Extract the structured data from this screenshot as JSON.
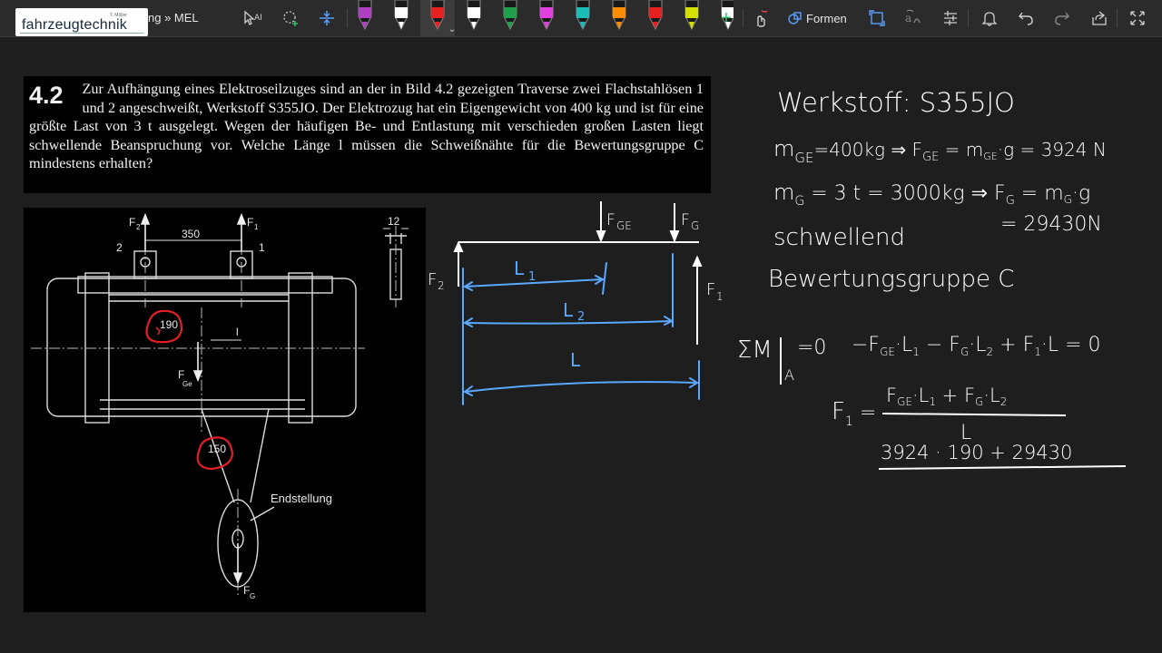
{
  "logo": {
    "text": "fahrzeugtechnik",
    "small_text": "T. Möller"
  },
  "breadcrumb": "ng » MEL",
  "toolbar": {
    "formen_label": "Formen",
    "pen_colors": [
      "#b03fc4",
      "#ffffff",
      "#e82020",
      "#ffffff",
      "#1fa04b",
      "#e040e0",
      "#1abeb6",
      "#ff8c00",
      "#e82020",
      "#d4e000",
      "#ffffff"
    ]
  },
  "task": {
    "number": "4.2",
    "text": "Zur Aufhängung eines Elektroseilzuges sind an der in Bild 4.2 gezeigten Traverse zwei Flachstahlösen 1 und 2 angeschweißt, Werkstoff S355JO. Der Elektrozug hat ein Eigengewicht von 400 kg und ist für eine größte Last von 3 t ausgelegt. Wegen der häufigen Be- und Entlastung mit verschieden großen Lasten liegt schwellende Beanspruchung vor. Welche Länge l müssen die Schweißnähte für die Bewertungsgruppe C mindestens erhalten?"
  },
  "figure": {
    "f2": "F",
    "f2_sub": "2",
    "f1": "F",
    "f1_sub": "1",
    "dim_350": "350",
    "dim_12": "12",
    "label_1": "1",
    "label_2": "2",
    "dim_190": "190",
    "dim_l": "l",
    "fge": "F",
    "fge_sub": "Ge",
    "dim_150": "150",
    "endstellung": "Endstellung",
    "fg": "F",
    "fg_sub": "G"
  },
  "sketch": {
    "fge": "F",
    "fge_sub": "GE",
    "fg": "F",
    "fg_sub": "G",
    "f2": "F",
    "f2_sub": "2",
    "f1": "F",
    "f1_sub": "1",
    "l1": "L",
    "l1_sub": "1",
    "l2": "L",
    "l2_sub": "2",
    "l": "L"
  },
  "notes": {
    "line1": "Werkstoff: S355JO",
    "mge": "m",
    "mge_sub": "GE",
    "mge_rest": "=400kg ⇒ F",
    "mge_fsub": "GE",
    "mge_eq": " = m",
    "mge_msub": "GE",
    "mge_end": "·g = 3924 N",
    "mg": "m",
    "mg_sub": "G",
    "mg_rest": " = 3 t = 3000kg ⇒ F",
    "mg_fsub": "G",
    "mg_eq": " = m",
    "mg_msub": "G",
    "mg_end": "·g",
    "mg_result": "= 29430N",
    "schwellend": "schwellend",
    "bewertung": "Bewertungsgruppe C",
    "sum_m": "ΣM",
    "sum_a": "A",
    "sum_eq": "=0",
    "moment_eq": "−F",
    "moment_fsub1": "GE",
    "moment_p1": "·L",
    "moment_lsub1": "1",
    "moment_p2": " − F",
    "moment_fsub2": "G",
    "moment_p3": "·L",
    "moment_lsub2": "2",
    "moment_p4": " + F",
    "moment_fsub3": "1",
    "moment_p5": "·L = 0",
    "f1": "F",
    "f1_sub": "1",
    "f1_eq": " =",
    "numerator": "F",
    "num_sub1": "GE",
    "num_p1": "·L",
    "num_lsub1": "1",
    "num_p2": " + F",
    "num_sub2": "G",
    "num_p3": "·L",
    "num_lsub2": "2",
    "denominator": "L",
    "calc": "3924 · 190 + 29430"
  }
}
